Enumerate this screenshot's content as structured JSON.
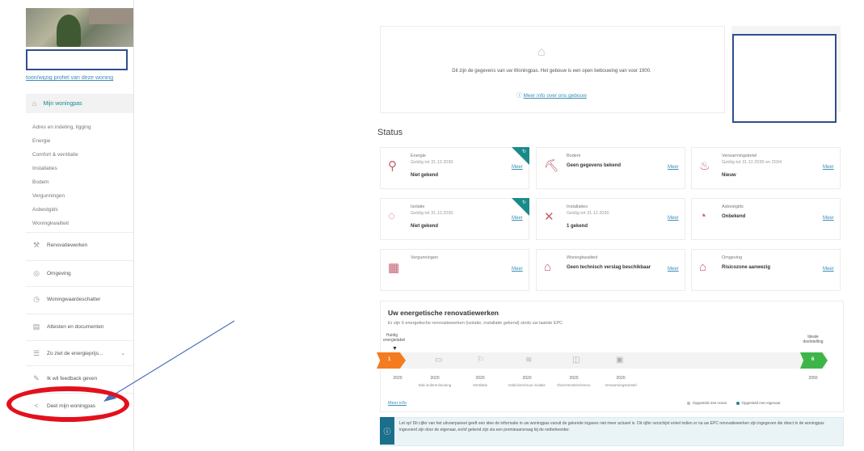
{
  "sidebar": {
    "address_link": "toon/wijzig profiel van deze woning",
    "main_item": "Mijn woningpas",
    "subitems": [
      "Adres en indeling, ligging",
      "Energie",
      "Comfort & ventilatie",
      "Installaties",
      "Bodem",
      "Vergunningen",
      "Asbestgids",
      "Woningkwaliteit"
    ],
    "items": [
      {
        "label": "Renovatiewerken",
        "icon": "hammer-icon",
        "glyph": "⚒"
      },
      {
        "label": "Omgeving",
        "icon": "location-icon",
        "glyph": "◎"
      },
      {
        "label": "Woningwaardeschatter",
        "icon": "chart-icon",
        "glyph": "◷"
      },
      {
        "label": "Attesten en documenten",
        "icon": "document-icon",
        "glyph": "▤"
      },
      {
        "label": "Zo ziet de energieprijs...",
        "icon": "list-icon",
        "glyph": "☰",
        "chevron": "⌄"
      },
      {
        "label": "Ik wil feedback geven",
        "icon": "comment-icon",
        "glyph": "✎"
      },
      {
        "label": "Deel mijn woningpas",
        "icon": "share-icon",
        "glyph": "<"
      }
    ]
  },
  "banner": {
    "text": "Dit zijn de gegevens van uw Woningpas. Het gebouw is een open bebouwing van voor 1900.",
    "link": "Meer info over ons gebouw"
  },
  "status": {
    "title": "Status",
    "cards": [
      {
        "title": "Energie",
        "sub": "Geldig tot 31.12.2030",
        "value": "Niet gekend",
        "link": "Meer",
        "icon": "energy-icon",
        "glyph": "⚲",
        "corner": true
      },
      {
        "title": "Bodem",
        "sub": "",
        "value": "Geen gegevens bekend",
        "link": "Meer",
        "icon": "soil-icon",
        "glyph": "⛏",
        "corner": false
      },
      {
        "title": "Verwarmingsketel",
        "sub": "Geldig tot 31.12.2030 en 2034",
        "value": "Nieuw",
        "link": "Meer",
        "icon": "heating-icon",
        "glyph": "♨",
        "corner": false
      },
      {
        "title": "Isolatie",
        "sub": "Geldig tot 31.12.2030",
        "value": "Niet gekend",
        "link": "Meer",
        "icon": "insulation-icon",
        "glyph": "◌",
        "corner": true
      },
      {
        "title": "Installaties",
        "sub": "Geldig tot 31.12.2030",
        "value": "1 gekend",
        "link": "Meer",
        "icon": "tools-icon",
        "glyph": "✕",
        "corner": false
      },
      {
        "title": "Asbestgids",
        "sub": "",
        "value": "Onbekend",
        "link": "Meer",
        "icon": "asbestos-icon",
        "glyph": "◔",
        "corner": false
      },
      {
        "title": "Vergunningen",
        "sub": "",
        "value": "",
        "link": "Meer",
        "icon": "permit-icon",
        "glyph": "▦",
        "corner": false
      },
      {
        "title": "Woningkwaliteit",
        "sub": "",
        "value": "Geen technisch verslag beschikbaar",
        "link": "Meer",
        "icon": "house-icon",
        "glyph": "⌂",
        "corner": false
      },
      {
        "title": "Omgeving",
        "sub": "",
        "value": "Risicozone aanwezig",
        "link": "Meer",
        "icon": "area-icon",
        "glyph": "⌂",
        "corner": false
      }
    ]
  },
  "panel": {
    "title": "Uw energetische renovatiewerken",
    "desc": "Er zijn 6 energetische renovatiewerken (isolatie, installatie gekend) sinds uw laatste EPC",
    "start_label": "Huidig energielabel",
    "end_label": "Ideale doelstelling",
    "start_num": "1",
    "end_num": "6",
    "steps": [
      {
        "year": "2020",
        "sub": "",
        "icon": "orange"
      },
      {
        "year": "2020",
        "sub": "Dak isoleren/woning",
        "glyph": "▭"
      },
      {
        "year": "2020",
        "sub": "Ventilatie",
        "glyph": "⚐"
      },
      {
        "year": "2020",
        "sub": "Dak/vloer/muur isolatie",
        "glyph": "≋"
      },
      {
        "year": "2020",
        "sub": "Vloer/vensters/renov.",
        "glyph": "◫"
      },
      {
        "year": "2020",
        "sub": "Verwarmingstoestel",
        "glyph": "▣"
      },
      {
        "year": "2050",
        "sub": "",
        "icon": "green"
      }
    ],
    "meer_info": "Meer info",
    "legend_1": "Opgesteld met scans",
    "legend_2": "Opgesteld met eigenaar"
  },
  "notice": {
    "text": "Let op! Dit cijfer van het uitvoerpaneel geeft een idee de informatie in uw woningpas vanuit de gekende ingaves niet meer actueel is. Dit cijfer verschijnt enkel indien er na uw EPC renovatiewerken zijn ingegeven die direct in de woningpas ingevoerd zijn door de eigenaar, en/of gekend zijn via een premieaanvraag bij de netbeheerder."
  },
  "colors": {
    "accent": "#1a8a8a",
    "orange": "#f47b20",
    "green": "#3fb549",
    "annotation_red": "#e3101d",
    "annotation_blue": "#2f4f8f"
  }
}
